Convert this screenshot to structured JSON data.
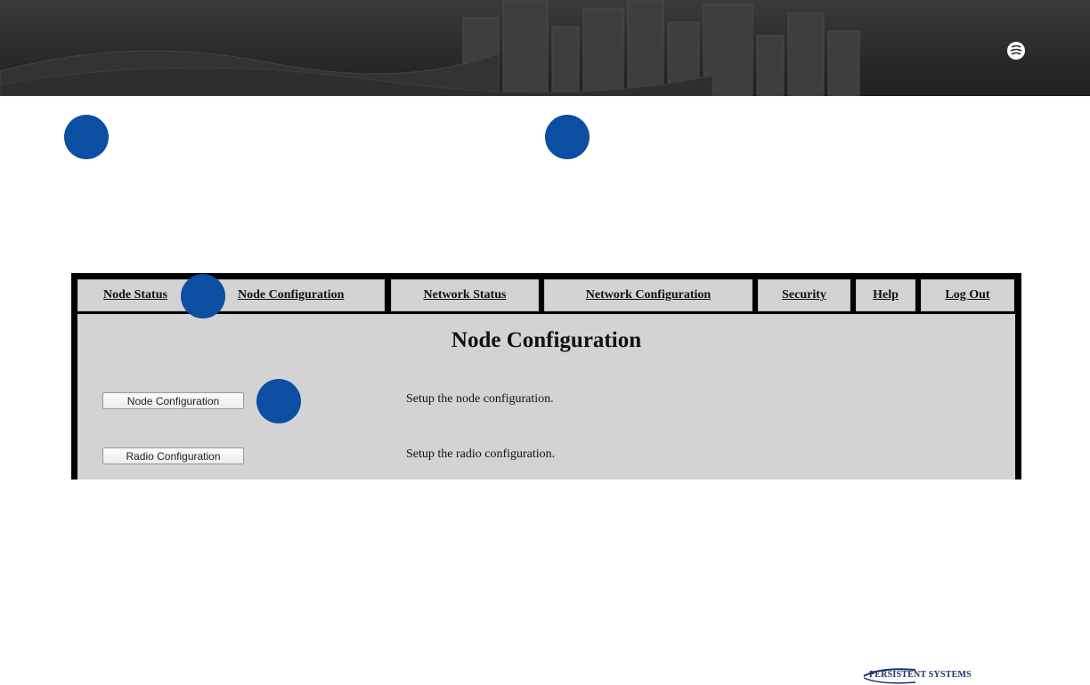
{
  "nav": {
    "items": [
      {
        "label": "Node Status"
      },
      {
        "label": "Node Configuration"
      },
      {
        "label": "Network Status"
      },
      {
        "label": "Network Configuration"
      },
      {
        "label": "Security"
      },
      {
        "label": "Help"
      },
      {
        "label": "Log Out"
      }
    ]
  },
  "page": {
    "title": "Node Configuration",
    "rows": [
      {
        "button": "Node Configuration",
        "description": "Setup the node configuration."
      },
      {
        "button": "Radio Configuration",
        "description": "Setup the radio configuration."
      }
    ]
  },
  "branding": {
    "company": "PERSISTENT SYSTEMS",
    "step_color": "#0b4ea2",
    "banner_color": "#2b2b2b",
    "panel_color": "#d3d3d3"
  }
}
